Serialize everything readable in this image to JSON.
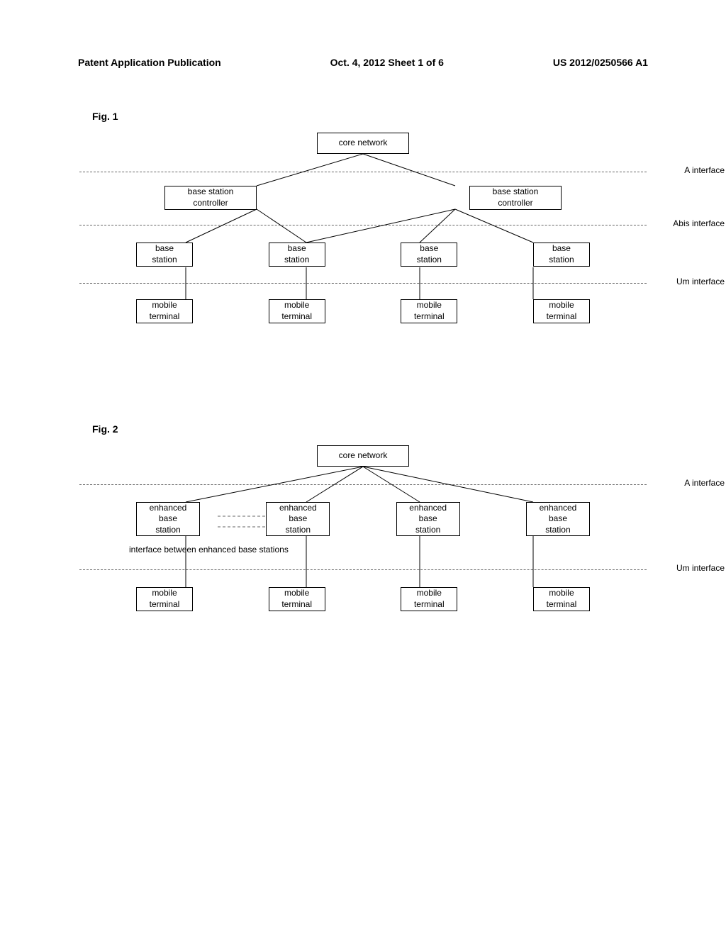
{
  "header": {
    "left": "Patent Application Publication",
    "center": "Oct. 4, 2012  Sheet 1 of 6",
    "right": "US 2012/0250566 A1"
  },
  "fig1": {
    "label": "Fig. 1",
    "core": "core network",
    "bsc": "base station\ncontroller",
    "bs": "base\nstation",
    "mt": "mobile\nterminal",
    "iface_a": "A interface",
    "iface_abis": "Abis interface",
    "iface_um": "Um interface"
  },
  "fig2": {
    "label": "Fig. 2",
    "core": "core network",
    "ebs": "enhanced\nbase\nstation",
    "mt": "mobile\nterminal",
    "iface_a": "A interface",
    "iface_um": "Um interface",
    "inter_label": "interface between enhanced base stations"
  },
  "chart_data": [
    {
      "type": "diagram",
      "title": "Fig. 1 — GSM network hierarchy",
      "nodes": [
        {
          "id": "core",
          "label": "core network",
          "layer": 0
        },
        {
          "id": "bsc1",
          "label": "base station controller",
          "layer": 1
        },
        {
          "id": "bsc2",
          "label": "base station controller",
          "layer": 1
        },
        {
          "id": "bs1",
          "label": "base station",
          "layer": 2
        },
        {
          "id": "bs2",
          "label": "base station",
          "layer": 2
        },
        {
          "id": "bs3",
          "label": "base station",
          "layer": 2
        },
        {
          "id": "bs4",
          "label": "base station",
          "layer": 2
        },
        {
          "id": "mt1",
          "label": "mobile terminal",
          "layer": 3
        },
        {
          "id": "mt2",
          "label": "mobile terminal",
          "layer": 3
        },
        {
          "id": "mt3",
          "label": "mobile terminal",
          "layer": 3
        },
        {
          "id": "mt4",
          "label": "mobile terminal",
          "layer": 3
        }
      ],
      "edges": [
        [
          "core",
          "bsc1"
        ],
        [
          "core",
          "bsc2"
        ],
        [
          "bsc1",
          "bs1"
        ],
        [
          "bsc1",
          "bs2"
        ],
        [
          "bsc2",
          "bs2"
        ],
        [
          "bsc2",
          "bs3"
        ],
        [
          "bsc2",
          "bs4"
        ],
        [
          "bs1",
          "mt1"
        ],
        [
          "bs2",
          "mt2"
        ],
        [
          "bs3",
          "mt3"
        ],
        [
          "bs4",
          "mt4"
        ]
      ],
      "interfaces": [
        {
          "between": [
            0,
            1
          ],
          "name": "A interface"
        },
        {
          "between": [
            1,
            2
          ],
          "name": "Abis interface"
        },
        {
          "between": [
            2,
            3
          ],
          "name": "Um interface"
        }
      ]
    },
    {
      "type": "diagram",
      "title": "Fig. 2 — flat enhanced-base-station architecture",
      "nodes": [
        {
          "id": "core",
          "label": "core network",
          "layer": 0
        },
        {
          "id": "ebs1",
          "label": "enhanced base station",
          "layer": 1
        },
        {
          "id": "ebs2",
          "label": "enhanced base station",
          "layer": 1
        },
        {
          "id": "ebs3",
          "label": "enhanced base station",
          "layer": 1
        },
        {
          "id": "ebs4",
          "label": "enhanced base station",
          "layer": 1
        },
        {
          "id": "mt1",
          "label": "mobile terminal",
          "layer": 2
        },
        {
          "id": "mt2",
          "label": "mobile terminal",
          "layer": 2
        },
        {
          "id": "mt3",
          "label": "mobile terminal",
          "layer": 2
        },
        {
          "id": "mt4",
          "label": "mobile terminal",
          "layer": 2
        }
      ],
      "edges": [
        [
          "core",
          "ebs1"
        ],
        [
          "core",
          "ebs2"
        ],
        [
          "core",
          "ebs3"
        ],
        [
          "core",
          "ebs4"
        ],
        [
          "ebs1",
          "ebs2"
        ],
        [
          "ebs1",
          "mt1"
        ],
        [
          "ebs2",
          "mt2"
        ],
        [
          "ebs3",
          "mt3"
        ],
        [
          "ebs4",
          "mt4"
        ]
      ],
      "interfaces": [
        {
          "between": [
            0,
            1
          ],
          "name": "A interface"
        },
        {
          "between": [
            1,
            1
          ],
          "name": "interface between enhanced base stations"
        },
        {
          "between": [
            1,
            2
          ],
          "name": "Um interface"
        }
      ]
    }
  ]
}
